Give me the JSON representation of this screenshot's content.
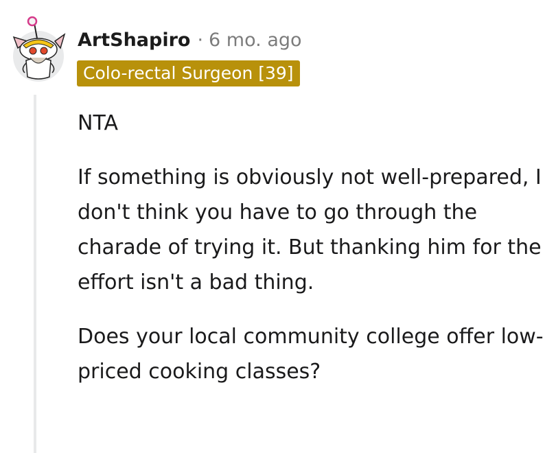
{
  "comment": {
    "username": "ArtShapiro",
    "separator": "·",
    "timestamp": "6 mo. ago",
    "flair": "Colo-rectal Surgeon [39]",
    "flair_color": "#b8910b",
    "avatar_icon": "snoo-avatar-icon",
    "paragraphs": [
      "NTA",
      "If something is obviously not well-prepared, I don't think you have to go through the charade of trying it. But thanking him for the effort isn't a bad thing.",
      "Does your local community college offer low-priced cooking classes?"
    ]
  }
}
